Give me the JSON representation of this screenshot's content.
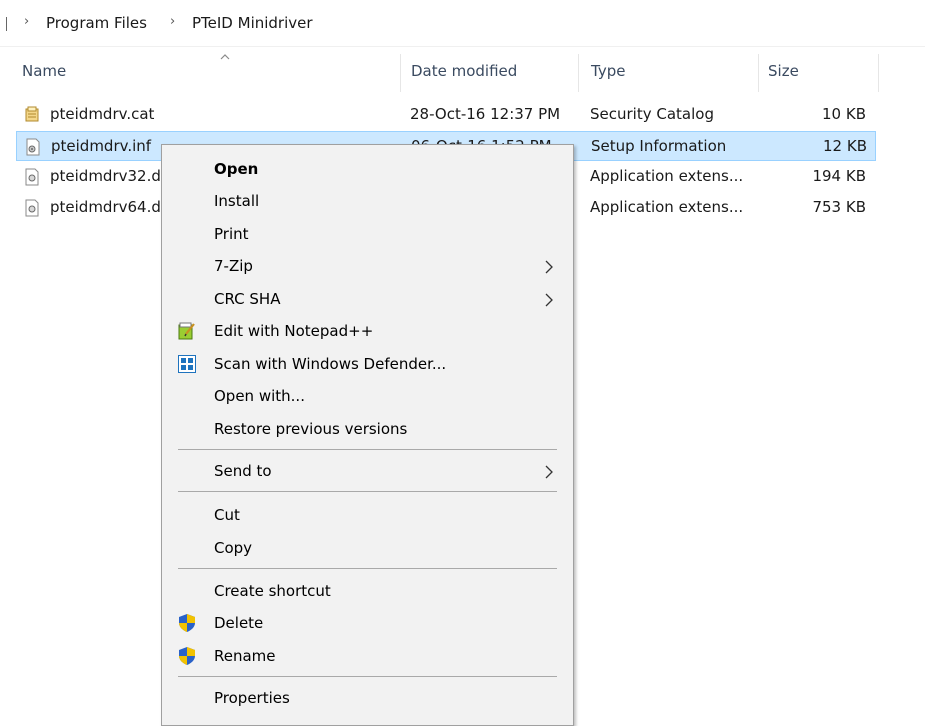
{
  "breadcrumb": {
    "items": [
      "Program Files",
      "PTeID Minidriver"
    ]
  },
  "columns": {
    "name": "Name",
    "date": "Date modified",
    "type": "Type",
    "size": "Size"
  },
  "files": [
    {
      "name": "pteidmdrv.cat",
      "date": "28-Oct-16 12:37 PM",
      "type": "Security Catalog",
      "size": "10 KB",
      "icon": "security-catalog-icon",
      "selected": false
    },
    {
      "name": "pteidmdrv.inf",
      "date": "06-Oct-16 1:52 PM",
      "type": "Setup Information",
      "size": "12 KB",
      "icon": "setup-information-icon",
      "selected": true
    },
    {
      "name": "pteidmdrv32.dll",
      "date": "",
      "type": "Application extens...",
      "size": "194 KB",
      "icon": "application-extension-icon",
      "selected": false
    },
    {
      "name": "pteidmdrv64.dll",
      "date": "",
      "type": "Application extens...",
      "size": "753 KB",
      "icon": "application-extension-icon",
      "selected": false
    }
  ],
  "context_menu": {
    "open": "Open",
    "install": "Install",
    "print": "Print",
    "seven_zip": "7-Zip",
    "crc_sha": "CRC SHA",
    "edit_notepad": "Edit with Notepad++",
    "scan_defender": "Scan with Windows Defender...",
    "open_with": "Open with...",
    "restore_versions": "Restore previous versions",
    "send_to": "Send to",
    "cut": "Cut",
    "copy": "Copy",
    "create_shortcut": "Create shortcut",
    "delete": "Delete",
    "rename": "Rename",
    "properties": "Properties"
  },
  "colors": {
    "selection_bg": "#cce8ff",
    "selection_border": "#99d1ff",
    "menu_bg": "#f2f2f2"
  }
}
